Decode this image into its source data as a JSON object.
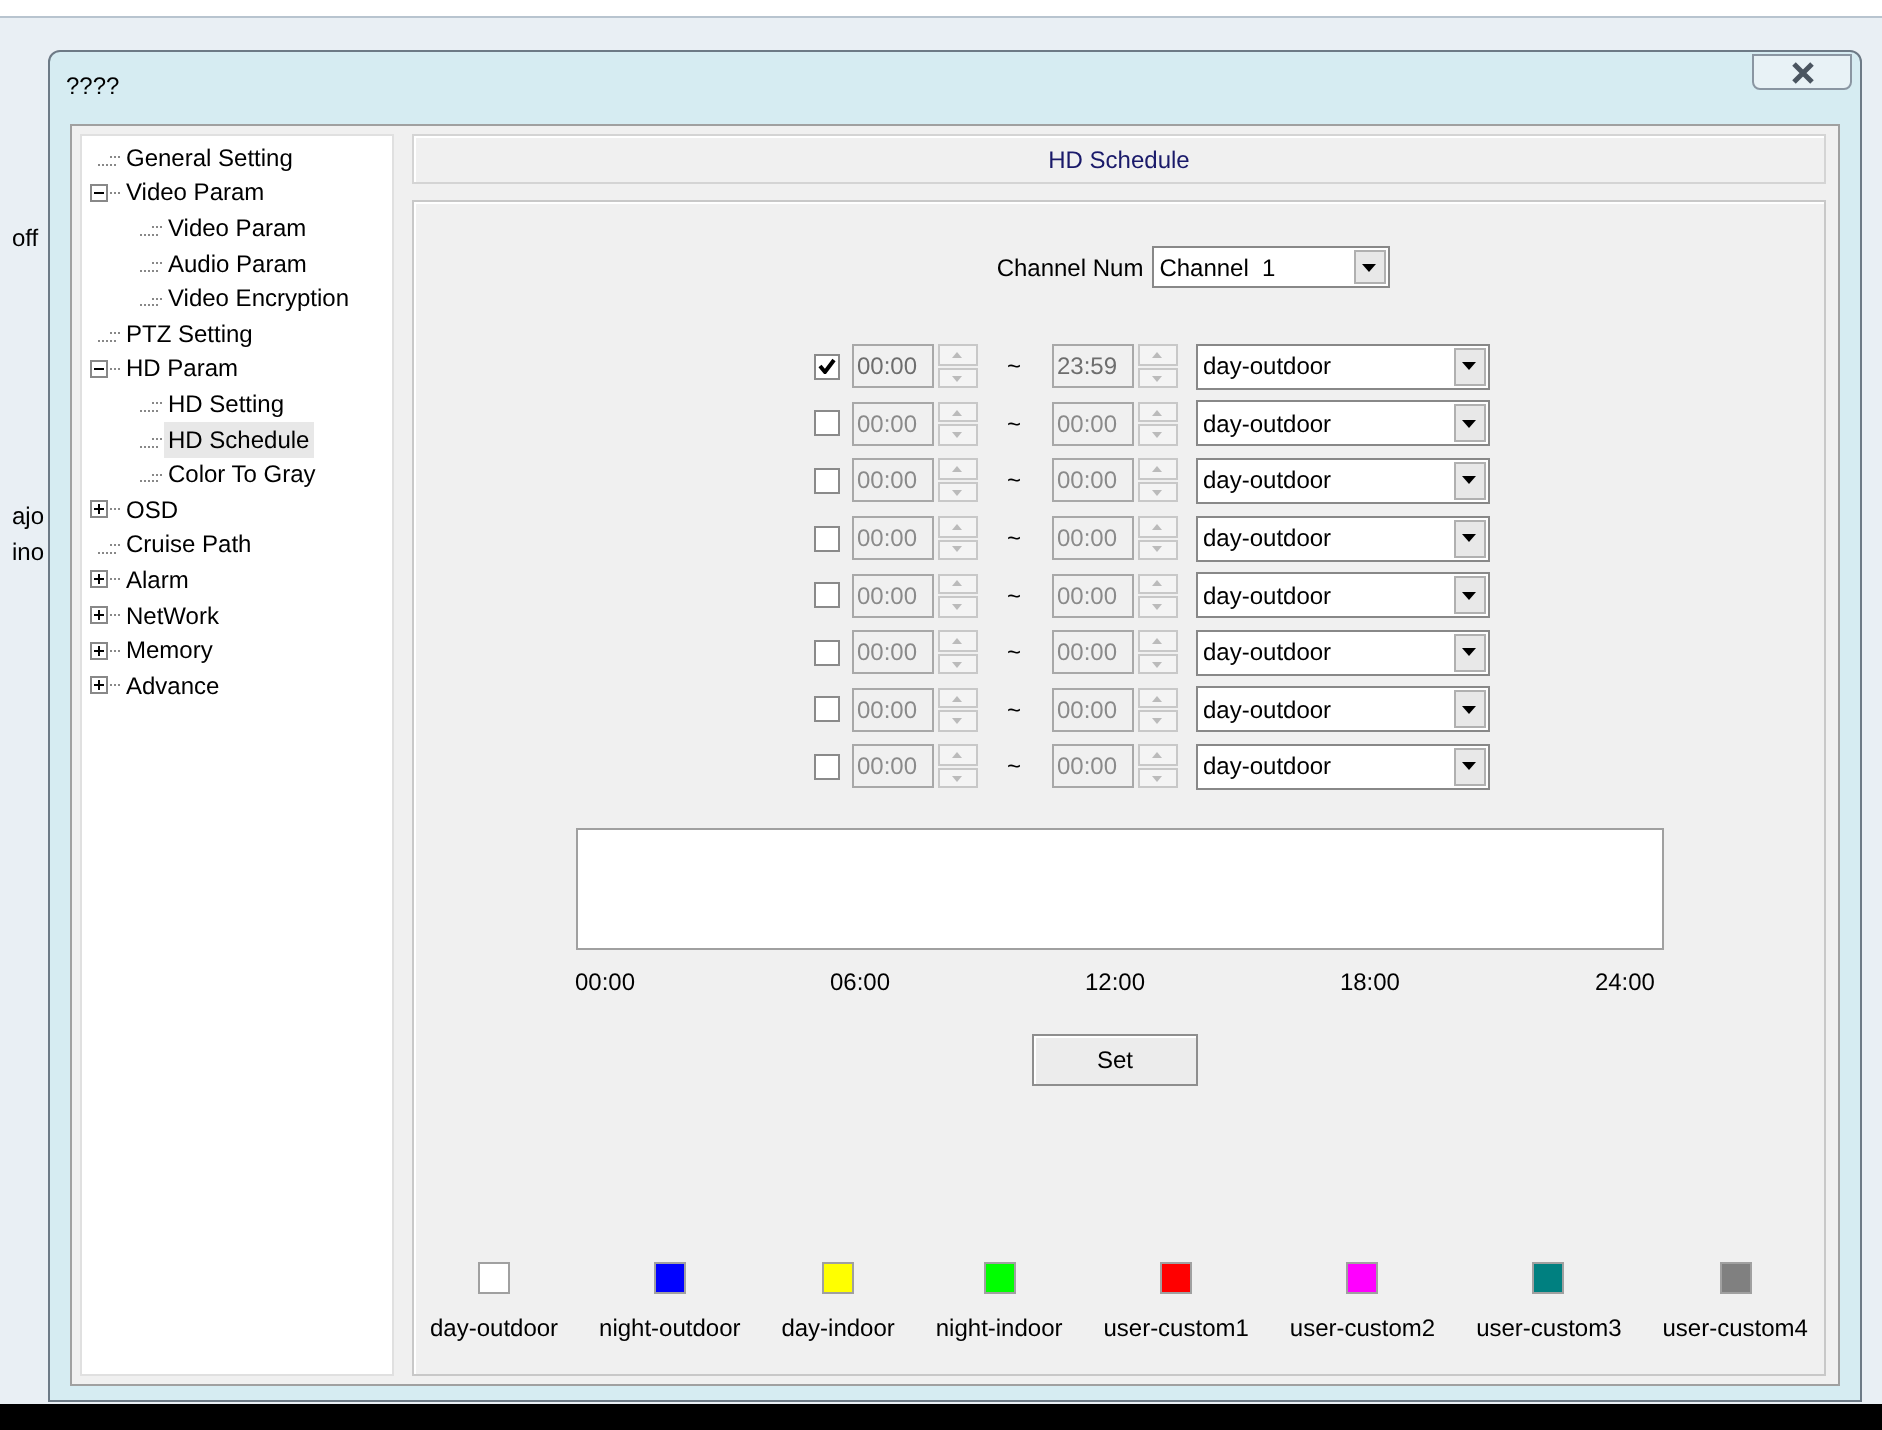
{
  "background": {
    "texts": [
      "off",
      "ajo",
      "ino"
    ]
  },
  "window": {
    "title": "????"
  },
  "tree": [
    {
      "label": "General Setting",
      "kind": "leaf",
      "selected": false
    },
    {
      "label": "Video Param",
      "kind": "folder",
      "expanded": true,
      "selected": false,
      "children": [
        {
          "label": "Video Param",
          "kind": "leaf",
          "selected": false
        },
        {
          "label": "Audio Param",
          "kind": "leaf",
          "selected": false
        },
        {
          "label": "Video Encryption",
          "kind": "leaf",
          "selected": false
        }
      ]
    },
    {
      "label": "PTZ Setting",
      "kind": "leaf",
      "selected": false
    },
    {
      "label": "HD Param",
      "kind": "folder",
      "expanded": true,
      "selected": false,
      "children": [
        {
          "label": "HD Setting",
          "kind": "leaf",
          "selected": false
        },
        {
          "label": "HD Schedule",
          "kind": "leaf",
          "selected": true
        },
        {
          "label": "Color To Gray",
          "kind": "leaf",
          "selected": false
        }
      ]
    },
    {
      "label": "OSD",
      "kind": "folder",
      "expanded": false,
      "selected": false
    },
    {
      "label": "Cruise Path",
      "kind": "leaf",
      "selected": false
    },
    {
      "label": "Alarm",
      "kind": "folder",
      "expanded": false,
      "selected": false
    },
    {
      "label": "NetWork",
      "kind": "folder",
      "expanded": false,
      "selected": false
    },
    {
      "label": "Memory",
      "kind": "folder",
      "expanded": false,
      "selected": false
    },
    {
      "label": "Advance",
      "kind": "folder",
      "expanded": false,
      "selected": false
    }
  ],
  "panel": {
    "title": "HD Schedule",
    "channel_label": "Channel Num",
    "channel_value": "Channel  1",
    "rows": [
      {
        "checked": true,
        "start": "00:00",
        "end": "23:59",
        "mode": "day-outdoor"
      },
      {
        "checked": false,
        "start": "00:00",
        "end": "00:00",
        "mode": "day-outdoor"
      },
      {
        "checked": false,
        "start": "00:00",
        "end": "00:00",
        "mode": "day-outdoor"
      },
      {
        "checked": false,
        "start": "00:00",
        "end": "00:00",
        "mode": "day-outdoor"
      },
      {
        "checked": false,
        "start": "00:00",
        "end": "00:00",
        "mode": "day-outdoor"
      },
      {
        "checked": false,
        "start": "00:00",
        "end": "00:00",
        "mode": "day-outdoor"
      },
      {
        "checked": false,
        "start": "00:00",
        "end": "00:00",
        "mode": "day-outdoor"
      },
      {
        "checked": false,
        "start": "00:00",
        "end": "00:00",
        "mode": "day-outdoor"
      }
    ],
    "separator": "~",
    "timeline_labels": [
      "00:00",
      "06:00",
      "12:00",
      "18:00",
      "24:00"
    ],
    "set_button": "Set",
    "legend": [
      {
        "label": "day-outdoor",
        "color": "#ffffff"
      },
      {
        "label": "night-outdoor",
        "color": "#0000ff"
      },
      {
        "label": "day-indoor",
        "color": "#ffff00"
      },
      {
        "label": "night-indoor",
        "color": "#00ff00"
      },
      {
        "label": "user-custom1",
        "color": "#ff0000"
      },
      {
        "label": "user-custom2",
        "color": "#ff00ff"
      },
      {
        "label": "user-custom3",
        "color": "#008080"
      },
      {
        "label": "user-custom4",
        "color": "#808080"
      }
    ]
  }
}
